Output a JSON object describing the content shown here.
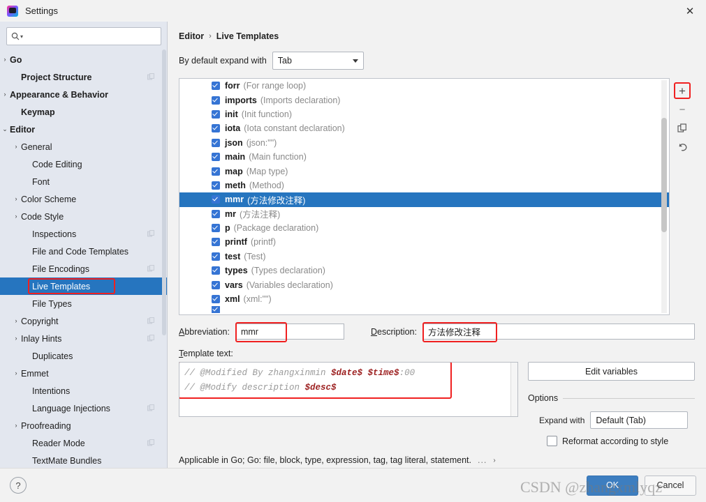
{
  "window": {
    "title": "Settings",
    "close_label": "✕",
    "app_icon": "jetbrains-goland-logo"
  },
  "sidebar": {
    "search": {
      "placeholder": "",
      "value": "",
      "icon": "search-icon"
    },
    "items": [
      {
        "label": "Go",
        "arrow": "›",
        "bold": true,
        "indent": 14,
        "trailing": false,
        "selected": false
      },
      {
        "label": "Project Structure",
        "arrow": "",
        "bold": true,
        "indent": 30,
        "trailing": true,
        "selected": false
      },
      {
        "label": "Appearance & Behavior",
        "arrow": "›",
        "bold": true,
        "indent": 14,
        "trailing": false,
        "selected": false
      },
      {
        "label": "Keymap",
        "arrow": "",
        "bold": true,
        "indent": 30,
        "trailing": false,
        "selected": false
      },
      {
        "label": "Editor",
        "arrow": "⌄",
        "bold": true,
        "indent": 14,
        "trailing": false,
        "selected": false
      },
      {
        "label": "General",
        "arrow": "›",
        "bold": false,
        "indent": 30,
        "trailing": false,
        "selected": false
      },
      {
        "label": "Code Editing",
        "arrow": "",
        "bold": false,
        "indent": 46,
        "trailing": false,
        "selected": false
      },
      {
        "label": "Font",
        "arrow": "",
        "bold": false,
        "indent": 46,
        "trailing": false,
        "selected": false
      },
      {
        "label": "Color Scheme",
        "arrow": "›",
        "bold": false,
        "indent": 30,
        "trailing": false,
        "selected": false
      },
      {
        "label": "Code Style",
        "arrow": "›",
        "bold": false,
        "indent": 30,
        "trailing": false,
        "selected": false
      },
      {
        "label": "Inspections",
        "arrow": "",
        "bold": false,
        "indent": 46,
        "trailing": true,
        "selected": false
      },
      {
        "label": "File and Code Templates",
        "arrow": "",
        "bold": false,
        "indent": 46,
        "trailing": false,
        "selected": false
      },
      {
        "label": "File Encodings",
        "arrow": "",
        "bold": false,
        "indent": 46,
        "trailing": true,
        "selected": false
      },
      {
        "label": "Live Templates",
        "arrow": "",
        "bold": false,
        "indent": 46,
        "trailing": false,
        "selected": true
      },
      {
        "label": "File Types",
        "arrow": "",
        "bold": false,
        "indent": 46,
        "trailing": false,
        "selected": false
      },
      {
        "label": "Copyright",
        "arrow": "›",
        "bold": false,
        "indent": 30,
        "trailing": true,
        "selected": false
      },
      {
        "label": "Inlay Hints",
        "arrow": "›",
        "bold": false,
        "indent": 30,
        "trailing": true,
        "selected": false
      },
      {
        "label": "Duplicates",
        "arrow": "",
        "bold": false,
        "indent": 46,
        "trailing": false,
        "selected": false
      },
      {
        "label": "Emmet",
        "arrow": "›",
        "bold": false,
        "indent": 30,
        "trailing": false,
        "selected": false
      },
      {
        "label": "Intentions",
        "arrow": "",
        "bold": false,
        "indent": 46,
        "trailing": false,
        "selected": false
      },
      {
        "label": "Language Injections",
        "arrow": "",
        "bold": false,
        "indent": 46,
        "trailing": true,
        "selected": false
      },
      {
        "label": "Proofreading",
        "arrow": "›",
        "bold": false,
        "indent": 30,
        "trailing": false,
        "selected": false
      },
      {
        "label": "Reader Mode",
        "arrow": "",
        "bold": false,
        "indent": 46,
        "trailing": true,
        "selected": false
      },
      {
        "label": "TextMate Bundles",
        "arrow": "",
        "bold": false,
        "indent": 46,
        "trailing": false,
        "selected": false
      }
    ]
  },
  "main": {
    "breadcrumb": {
      "parent": "Editor",
      "separator": "›",
      "current": "Live Templates"
    },
    "expand_with": {
      "label": "By default expand with",
      "value": "Tab"
    },
    "templates": [
      {
        "abbr": "forr",
        "desc": "(For range loop)",
        "checked": true,
        "selected": false
      },
      {
        "abbr": "imports",
        "desc": "(Imports declaration)",
        "checked": true,
        "selected": false
      },
      {
        "abbr": "init",
        "desc": "(Init function)",
        "checked": true,
        "selected": false
      },
      {
        "abbr": "iota",
        "desc": "(Iota constant declaration)",
        "checked": true,
        "selected": false
      },
      {
        "abbr": "json",
        "desc": "(json:\"\")",
        "checked": true,
        "selected": false
      },
      {
        "abbr": "main",
        "desc": "(Main function)",
        "checked": true,
        "selected": false
      },
      {
        "abbr": "map",
        "desc": "(Map type)",
        "checked": true,
        "selected": false
      },
      {
        "abbr": "meth",
        "desc": "(Method)",
        "checked": true,
        "selected": false
      },
      {
        "abbr": "mmr",
        "desc": "(方法修改注释)",
        "checked": true,
        "selected": true
      },
      {
        "abbr": "mr",
        "desc": "(方法注释)",
        "checked": true,
        "selected": false
      },
      {
        "abbr": "p",
        "desc": "(Package declaration)",
        "checked": true,
        "selected": false
      },
      {
        "abbr": "printf",
        "desc": "(printf)",
        "checked": true,
        "selected": false
      },
      {
        "abbr": "test",
        "desc": "(Test)",
        "checked": true,
        "selected": false
      },
      {
        "abbr": "types",
        "desc": "(Types declaration)",
        "checked": true,
        "selected": false
      },
      {
        "abbr": "vars",
        "desc": "(Variables declaration)",
        "checked": true,
        "selected": false
      },
      {
        "abbr": "xml",
        "desc": "(xml:\"\")",
        "checked": true,
        "selected": false
      }
    ],
    "list_tools": [
      {
        "name": "add-template-button",
        "glyph": "+"
      },
      {
        "name": "remove-template-button",
        "glyph": "−"
      },
      {
        "name": "duplicate-template-button",
        "glyph": "copy-icon"
      },
      {
        "name": "revert-template-button",
        "glyph": "undo-icon"
      }
    ],
    "abbreviation": {
      "label": "Abbreviation:",
      "value": "mmr"
    },
    "description": {
      "label": "Description:",
      "value": "方法修改注释"
    },
    "template_text": {
      "label": "Template text:",
      "lines": [
        {
          "prefix": "// @Modified By zhangxinmin ",
          "vars": "$date$ $time$",
          "suffix": ":00"
        },
        {
          "prefix": "// @Modify description  ",
          "vars": "$desc$",
          "suffix": ""
        }
      ]
    },
    "edit_variables_label": "Edit variables",
    "options": {
      "title": "Options",
      "expand_with_label": "Expand with",
      "expand_with_value": "Default (Tab)",
      "reformat_label": "Reformat according to style",
      "reformat_checked": false
    },
    "applicable": {
      "text": "Applicable in Go; Go: file, block, type, expression, tag, tag literal, statement.",
      "more": "...",
      "chevron": "›"
    }
  },
  "footer": {
    "help_label": "?",
    "ok_label": "OK",
    "cancel_label": "Cancel"
  },
  "watermark": {
    "text": "CSDN @zhangxmlyqz"
  },
  "colors": {
    "accent": "#2675bf",
    "sidebar_bg": "#e3e7ef",
    "panel_bg": "#f2f2f2",
    "highlight_ring": "#f02020",
    "ok_button": "#3d7ec0",
    "checkbox": "#3574d4",
    "template_var": "#9c1f1f"
  }
}
